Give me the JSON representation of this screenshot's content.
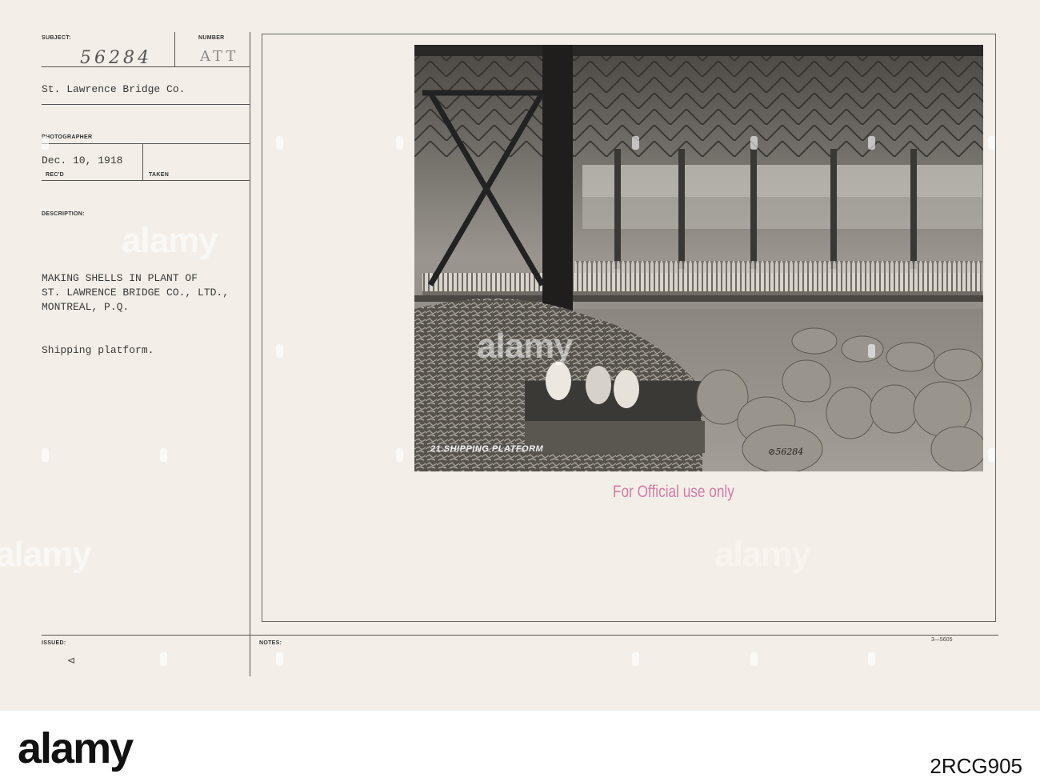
{
  "card": {
    "subject_label": "SUBJECT:",
    "number_label": "NUMBER",
    "negative_number": "56284",
    "number_value": "ATT",
    "subject_value": "St. Lawrence Bridge Co.",
    "photographer_label": "PHOTOGRAPHER",
    "received_date": "Dec. 10, 1918",
    "recd_label": "REC'D",
    "taken_label": "TAKEN",
    "description_label": "DESCRIPTION:",
    "description_lines": [
      "MAKING SHELLS IN PLANT OF",
      "ST. LAWRENCE BRIDGE CO., LTD.,",
      "MONTREAL, P.Q."
    ],
    "caption_note": "Shipping platform.",
    "issued_label": "ISSUED:",
    "notes_label": "NOTES:",
    "issued_mark": "⊲",
    "form_number": "3—5605",
    "photo_caption": "21.SHIPPING PLATFORM",
    "photo_number": "⊘56284",
    "stamp_text": "For Official use only"
  },
  "watermark": {
    "text": "alamy",
    "colors": {
      "card_bg": "#f3efe8",
      "stamp": "#d57aa6",
      "rule": "#555555"
    }
  },
  "footer": {
    "brand": "alamy",
    "image_id": "2RCG905"
  }
}
